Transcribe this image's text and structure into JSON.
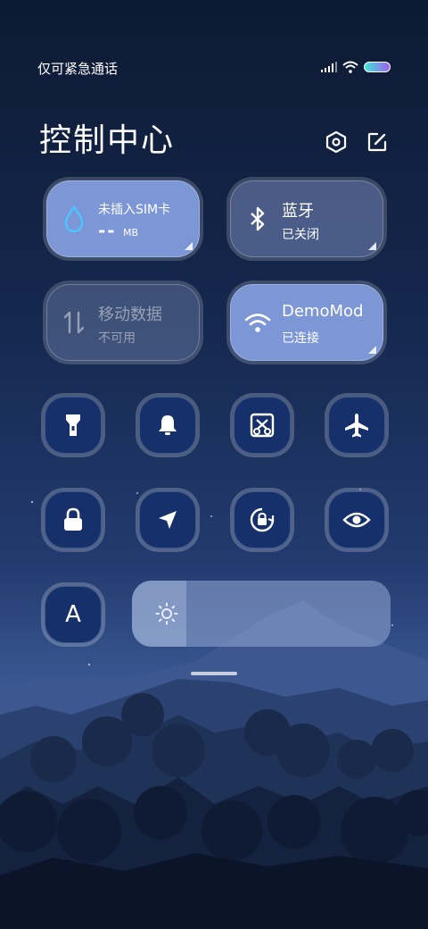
{
  "status_bar": {
    "carrier": "仅可紧急通话"
  },
  "header": {
    "title": "控制中心"
  },
  "tiles": {
    "sim": {
      "title": "未插入SIM卡",
      "value": "--",
      "unit": "MB"
    },
    "bluetooth": {
      "title": "蓝牙",
      "status": "已关闭"
    },
    "mobile_data": {
      "title": "移动数据",
      "status": "不可用"
    },
    "wifi": {
      "title": "DemoMod",
      "status": "已连接"
    }
  },
  "toggles_row1": [
    "flashlight-icon",
    "bell-icon",
    "screenshot-icon",
    "airplane-icon"
  ],
  "toggles_row2": [
    "lock-icon",
    "location-icon",
    "rotation-lock-icon",
    "eye-icon"
  ],
  "text_size_button": {
    "label": "A"
  },
  "brightness": {
    "level": 0.21
  },
  "colors": {
    "tile_on": "#7d97d6",
    "button_bg": "#15306a"
  }
}
